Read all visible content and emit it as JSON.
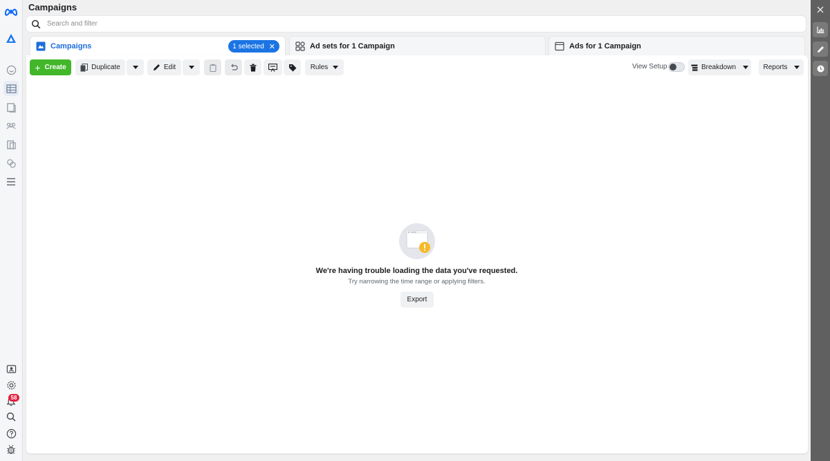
{
  "header": {
    "title": "Campaigns",
    "search_placeholder": "Search and filter"
  },
  "tabs": [
    {
      "label": "Campaigns",
      "icon": "campaign-flag-icon",
      "active": true,
      "selection": "1 selected"
    },
    {
      "label": "Ad sets for 1 Campaign",
      "icon": "ad-sets-grid-icon",
      "active": false
    },
    {
      "label": "Ads for 1 Campaign",
      "icon": "ad-frame-icon",
      "active": false
    }
  ],
  "toolbar": {
    "create_label": "Create",
    "duplicate_label": "Duplicate",
    "edit_label": "Edit",
    "rules_label": "Rules",
    "view_setup_label": "View Setup",
    "breakdown_label": "Breakdown",
    "reports_label": "Reports"
  },
  "empty_state": {
    "title": "We're having trouble loading the data you've requested.",
    "subtitle": "Try narrowing the time range or applying filters.",
    "export_label": "Export"
  },
  "nav": {
    "notifications_count": "58"
  },
  "colors": {
    "accent": "#1b74e4",
    "create_green": "#42b72a",
    "warning_yellow": "#f7b928",
    "badge_red": "#e41e3f"
  }
}
